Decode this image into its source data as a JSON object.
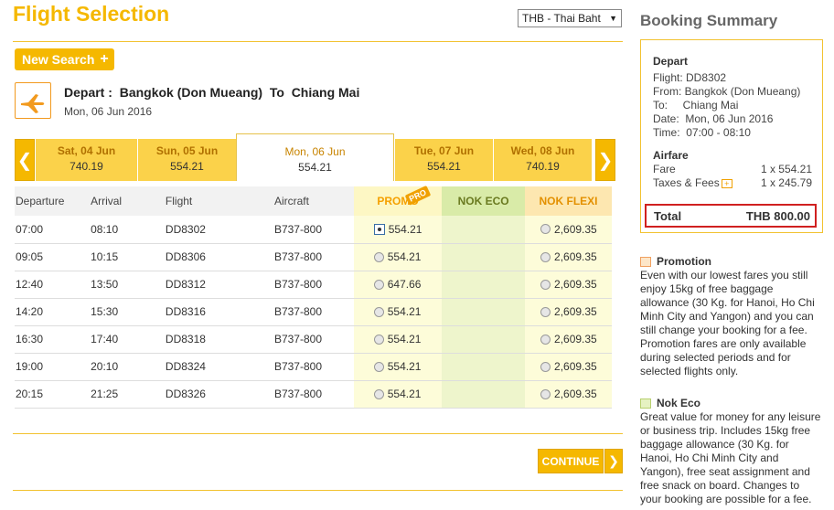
{
  "header": {
    "title": "Flight Selection",
    "currency": "THB - Thai Baht",
    "new_search": "New Search"
  },
  "route": {
    "depart_label": "Depart",
    "origin": "Bangkok (Don Mueang)",
    "to_label": "To",
    "destination": "Chiang Mai",
    "date": "Mon, 06 Jun 2016"
  },
  "dates": [
    {
      "day": "Sat, 04 Jun",
      "price": "740.19"
    },
    {
      "day": "Sun, 05 Jun",
      "price": "554.21"
    },
    {
      "day": "Mon, 06 Jun",
      "price": "554.21"
    },
    {
      "day": "Tue, 07 Jun",
      "price": "554.21"
    },
    {
      "day": "Wed, 08 Jun",
      "price": "740.19"
    }
  ],
  "table": {
    "headers": {
      "departure": "Departure",
      "arrival": "Arrival",
      "flight": "Flight",
      "aircraft": "Aircraft",
      "promo": "PROMO",
      "promo_tag": "PRO",
      "eco": "NOK ECO",
      "flexi": "NOK FLEXI"
    },
    "rows": [
      {
        "dep": "07:00",
        "arr": "08:10",
        "flight": "DD8302",
        "aircraft": "B737-800",
        "promo": "554.21",
        "flexi": "2,609.35"
      },
      {
        "dep": "09:05",
        "arr": "10:15",
        "flight": "DD8306",
        "aircraft": "B737-800",
        "promo": "554.21",
        "flexi": "2,609.35"
      },
      {
        "dep": "12:40",
        "arr": "13:50",
        "flight": "DD8312",
        "aircraft": "B737-800",
        "promo": "647.66",
        "flexi": "2,609.35"
      },
      {
        "dep": "14:20",
        "arr": "15:30",
        "flight": "DD8316",
        "aircraft": "B737-800",
        "promo": "554.21",
        "flexi": "2,609.35"
      },
      {
        "dep": "16:30",
        "arr": "17:40",
        "flight": "DD8318",
        "aircraft": "B737-800",
        "promo": "554.21",
        "flexi": "2,609.35"
      },
      {
        "dep": "19:00",
        "arr": "20:10",
        "flight": "DD8324",
        "aircraft": "B737-800",
        "promo": "554.21",
        "flexi": "2,609.35"
      },
      {
        "dep": "20:15",
        "arr": "21:25",
        "flight": "DD8326",
        "aircraft": "B737-800",
        "promo": "554.21",
        "flexi": "2,609.35"
      }
    ]
  },
  "continue_label": "CONTINUE",
  "summary": {
    "title": "Booking Summary",
    "depart_head": "Depart",
    "flight": "Flight: DD8302",
    "from": "From: Bangkok (Don Mueang)",
    "to": "To:     Chiang Mai",
    "date": "Date:  Mon, 06 Jun 2016",
    "time": "Time:  07:00 - 08:10",
    "airfare_head": "Airfare",
    "fare_label": "Fare",
    "fare_value": "1 x 554.21",
    "taxes_label": "Taxes & Fees",
    "taxes_value": "1 x 245.79",
    "total_label": "Total",
    "total_value": "THB 800.00"
  },
  "info": {
    "promo_head": "Promotion",
    "promo_text": "Even with our lowest fares you still enjoy 15kg of free baggage allowance (30 Kg. for Hanoi, Ho Chi Minh City and Yangon) and you can still change your booking for a fee. Promotion fares are only available during selected periods and for selected flights only.",
    "eco_head": "Nok Eco",
    "eco_text": "Great value for money for any leisure or business trip. Includes 15kg free baggage allowance (30 Kg. for Hanoi, Ho Chi Minh City and Yangon), free seat assignment and free snack on board. Changes to your booking are possible for a fee."
  },
  "colors": {
    "brand": "#f5b800",
    "total_border": "#d02020"
  }
}
